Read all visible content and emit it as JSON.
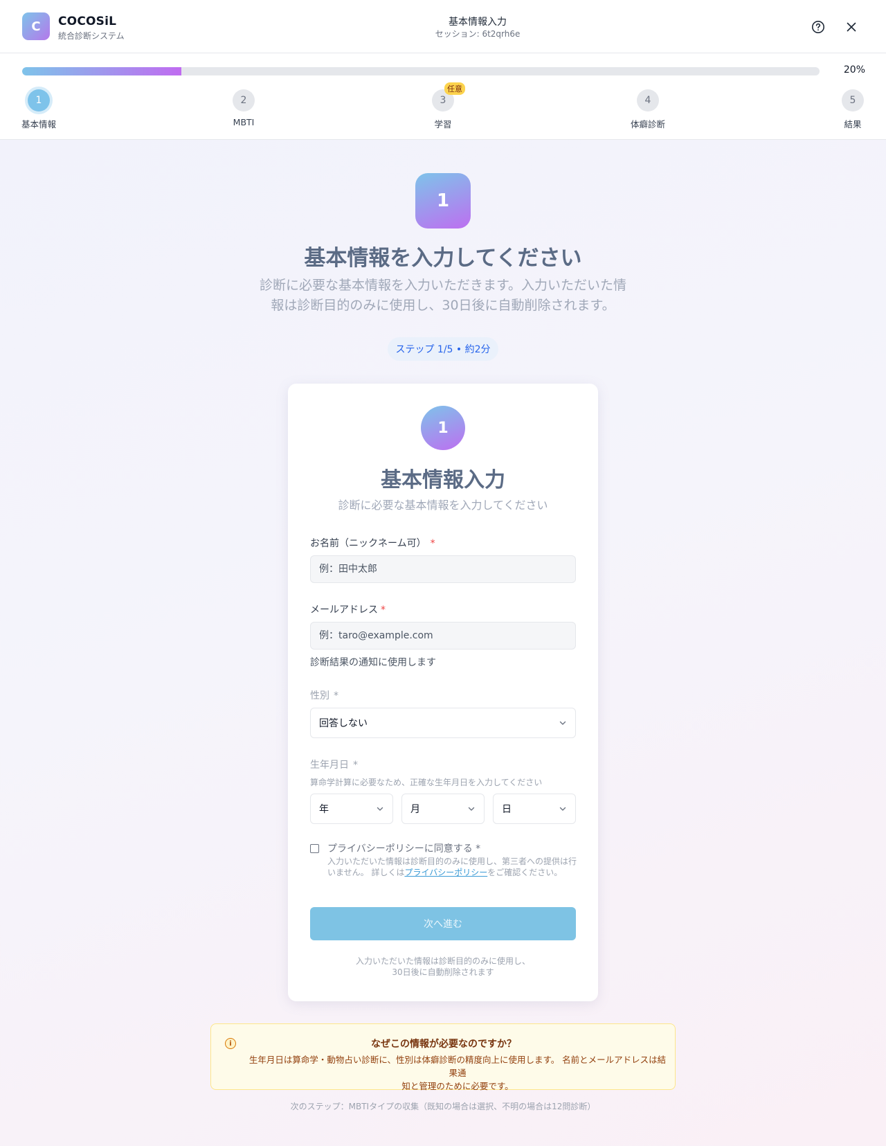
{
  "header": {
    "logo_letter": "C",
    "brand_name": "COCOSiL",
    "brand_sub": "統合診断システム",
    "title": "基本情報入力",
    "session": "セッション: 6t2qrh6e"
  },
  "progress": {
    "percent_label": "20%",
    "fraction": 0.2,
    "steps": [
      {
        "number": "1",
        "label": "基本情報"
      },
      {
        "number": "2",
        "label": "MBTI"
      },
      {
        "number": "3",
        "label": "学習",
        "badge": "任意"
      },
      {
        "number": "4",
        "label": "体癖診断"
      },
      {
        "number": "5",
        "label": "結果"
      }
    ]
  },
  "hero": {
    "number": "1",
    "title": "基本情報を入力してください",
    "desc_line1": "診断に必要な基本情報を入力いただきます。入力いただいた情",
    "desc_line2": "報は診断目的のみに使用し、30日後に自動削除されます。",
    "step_pill": "ステップ 1/5 • 約2分"
  },
  "form": {
    "number": "1",
    "title": "基本情報入力",
    "subtitle": "診断に必要な基本情報を入力してください",
    "name_label": "お名前（ニックネーム可）",
    "name_placeholder": "例：田中太郎",
    "email_label": "メールアドレス",
    "email_placeholder": "例：taro@example.com",
    "email_helper": "診断結果の通知に使用します",
    "gender_label": "性別",
    "gender_value": "回答しない",
    "birth_label": "生年月日",
    "birth_note": "算命学計算に必要なため、正確な生年月日を入力してください",
    "year": "年",
    "month": "月",
    "day": "日",
    "required_mark": "*",
    "consent_label": "プライバシーポリシーに同意する *",
    "consent_desc_1": "入力いただいた情報は診断目的のみに使用し、第三者への提供は行いません。 詳しくは",
    "consent_link": "プライバシーポリシー",
    "consent_desc_2": "をご確認ください。",
    "next_button": "次へ進む",
    "foot_line1": "入力いただいた情報は診断目的のみに使用し、",
    "foot_line2": "30日後に自動削除されます"
  },
  "info": {
    "icon": "info-icon",
    "title": "なぜこの情報が必要なのですか？",
    "text_line1": "生年月日は算命学・動物占い診断に、性別は体癖診断の精度向上に使用します。 名前とメールアドレスは結果通",
    "text_line2": "知と管理のために必要です。"
  },
  "next_step_note": "次のステップ：MBTIタイプの収集（既知の場合は選択、不明の場合は12問診断）",
  "colors": {
    "accent_blue": "#7ec3ea",
    "accent_purple": "#bd6ff0",
    "required_red": "#ef4444"
  }
}
